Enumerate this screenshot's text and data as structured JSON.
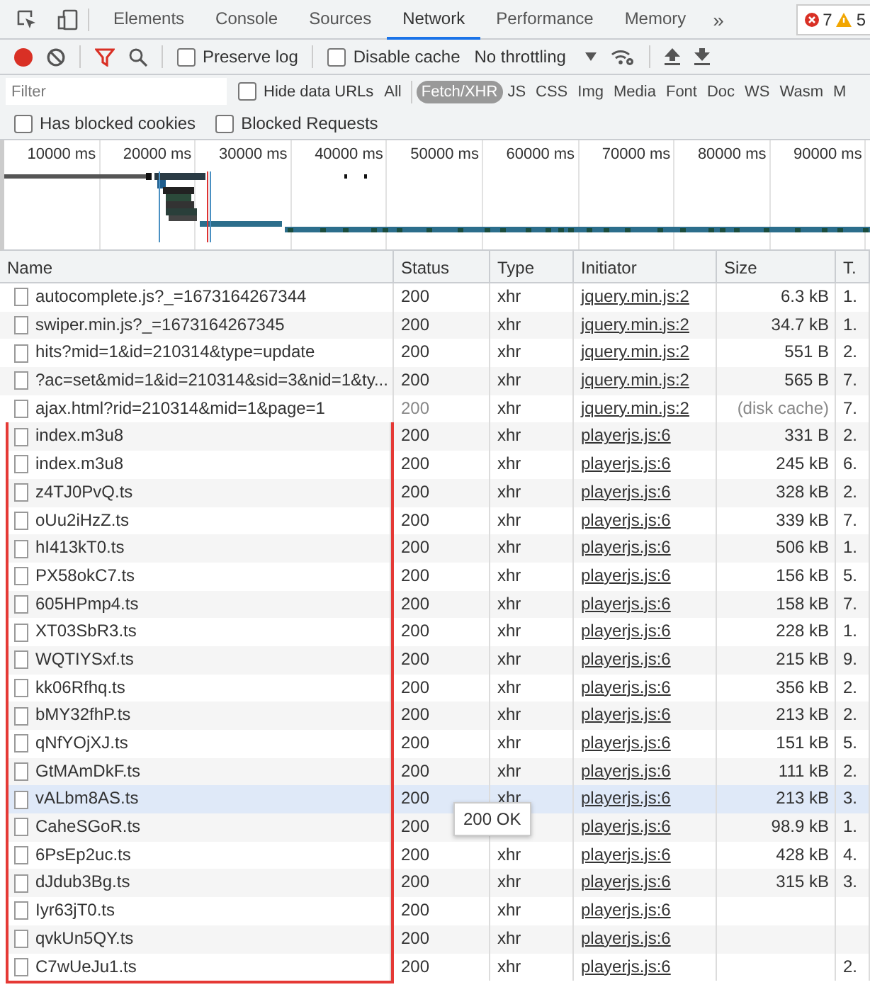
{
  "tabs": [
    {
      "label": "Elements",
      "selected": false
    },
    {
      "label": "Console",
      "selected": false
    },
    {
      "label": "Sources",
      "selected": false
    },
    {
      "label": "Network",
      "selected": true
    },
    {
      "label": "Performance",
      "selected": false
    },
    {
      "label": "Memory",
      "selected": false
    }
  ],
  "more_tabs": "»",
  "issues": {
    "errors": "7",
    "warnings": "5"
  },
  "toolbar": {
    "recording": true,
    "preserve_log": {
      "label": "Preserve log",
      "checked": false
    },
    "disable_cache": {
      "label": "Disable cache",
      "checked": false
    },
    "throttling": "No throttling"
  },
  "filter": {
    "placeholder": "Filter",
    "hide_data_urls": {
      "label": "Hide data URLs",
      "checked": false
    },
    "types": [
      {
        "label": "All",
        "selected": false
      },
      {
        "label": "Fetch/XHR",
        "selected": true
      },
      {
        "label": "JS",
        "selected": false
      },
      {
        "label": "CSS",
        "selected": false
      },
      {
        "label": "Img",
        "selected": false
      },
      {
        "label": "Media",
        "selected": false
      },
      {
        "label": "Font",
        "selected": false
      },
      {
        "label": "Doc",
        "selected": false
      },
      {
        "label": "WS",
        "selected": false
      },
      {
        "label": "Wasm",
        "selected": false
      },
      {
        "label": "M",
        "selected": false
      }
    ]
  },
  "blocked": [
    {
      "label": "Has blocked cookies",
      "checked": false
    },
    {
      "label": "Blocked Requests",
      "checked": false
    }
  ],
  "overview": {
    "ticks": [
      "10000 ms",
      "20000 ms",
      "30000 ms",
      "40000 ms",
      "50000 ms",
      "60000 ms",
      "70000 ms",
      "80000 ms",
      "90000 ms"
    ]
  },
  "table": {
    "columns": [
      "Name",
      "Status",
      "Type",
      "Initiator",
      "Size",
      "T."
    ],
    "rows": [
      {
        "name": "autocomplete.js?_=1673164267344",
        "status": "200",
        "type": "xhr",
        "initiator": "jquery.min.js:2",
        "size": "6.3 kB",
        "time": "1.",
        "from_cache": false,
        "boxed": false,
        "hovered": false
      },
      {
        "name": "swiper.min.js?_=1673164267345",
        "status": "200",
        "type": "xhr",
        "initiator": "jquery.min.js:2",
        "size": "34.7 kB",
        "time": "1.",
        "from_cache": false,
        "boxed": false,
        "hovered": false
      },
      {
        "name": "hits?mid=1&id=210314&type=update",
        "status": "200",
        "type": "xhr",
        "initiator": "jquery.min.js:2",
        "size": "551 B",
        "time": "2.",
        "from_cache": false,
        "boxed": false,
        "hovered": false
      },
      {
        "name": "?ac=set&mid=1&id=210314&sid=3&nid=1&ty...",
        "status": "200",
        "type": "xhr",
        "initiator": "jquery.min.js:2",
        "size": "565 B",
        "time": "7.",
        "from_cache": false,
        "boxed": false,
        "hovered": false
      },
      {
        "name": "ajax.html?rid=210314&mid=1&page=1",
        "status": "200",
        "type": "xhr",
        "initiator": "jquery.min.js:2",
        "size": "(disk cache)",
        "time": "7.",
        "from_cache": true,
        "boxed": false,
        "hovered": false
      },
      {
        "name": "index.m3u8",
        "status": "200",
        "type": "xhr",
        "initiator": "playerjs.js:6",
        "size": "331 B",
        "time": "2.",
        "from_cache": false,
        "boxed": true,
        "hovered": false
      },
      {
        "name": "index.m3u8",
        "status": "200",
        "type": "xhr",
        "initiator": "playerjs.js:6",
        "size": "245 kB",
        "time": "6.",
        "from_cache": false,
        "boxed": true,
        "hovered": false
      },
      {
        "name": "z4TJ0PvQ.ts",
        "status": "200",
        "type": "xhr",
        "initiator": "playerjs.js:6",
        "size": "328 kB",
        "time": "2.",
        "from_cache": false,
        "boxed": true,
        "hovered": false
      },
      {
        "name": "oUu2iHzZ.ts",
        "status": "200",
        "type": "xhr",
        "initiator": "playerjs.js:6",
        "size": "339 kB",
        "time": "7.",
        "from_cache": false,
        "boxed": true,
        "hovered": false
      },
      {
        "name": "hI413kT0.ts",
        "status": "200",
        "type": "xhr",
        "initiator": "playerjs.js:6",
        "size": "506 kB",
        "time": "1.",
        "from_cache": false,
        "boxed": true,
        "hovered": false
      },
      {
        "name": "PX58okC7.ts",
        "status": "200",
        "type": "xhr",
        "initiator": "playerjs.js:6",
        "size": "156 kB",
        "time": "5.",
        "from_cache": false,
        "boxed": true,
        "hovered": false
      },
      {
        "name": "605HPmp4.ts",
        "status": "200",
        "type": "xhr",
        "initiator": "playerjs.js:6",
        "size": "158 kB",
        "time": "7.",
        "from_cache": false,
        "boxed": true,
        "hovered": false
      },
      {
        "name": "XT03SbR3.ts",
        "status": "200",
        "type": "xhr",
        "initiator": "playerjs.js:6",
        "size": "228 kB",
        "time": "1.",
        "from_cache": false,
        "boxed": true,
        "hovered": false
      },
      {
        "name": "WQTIYSxf.ts",
        "status": "200",
        "type": "xhr",
        "initiator": "playerjs.js:6",
        "size": "215 kB",
        "time": "9.",
        "from_cache": false,
        "boxed": true,
        "hovered": false
      },
      {
        "name": "kk06Rfhq.ts",
        "status": "200",
        "type": "xhr",
        "initiator": "playerjs.js:6",
        "size": "356 kB",
        "time": "2.",
        "from_cache": false,
        "boxed": true,
        "hovered": false
      },
      {
        "name": "bMY32fhP.ts",
        "status": "200",
        "type": "xhr",
        "initiator": "playerjs.js:6",
        "size": "213 kB",
        "time": "2.",
        "from_cache": false,
        "boxed": true,
        "hovered": false
      },
      {
        "name": "qNfYOjXJ.ts",
        "status": "200",
        "type": "xhr",
        "initiator": "playerjs.js:6",
        "size": "151 kB",
        "time": "5.",
        "from_cache": false,
        "boxed": true,
        "hovered": false
      },
      {
        "name": "GtMAmDkF.ts",
        "status": "200",
        "type": "xhr",
        "initiator": "playerjs.js:6",
        "size": "111 kB",
        "time": "2.",
        "from_cache": false,
        "boxed": true,
        "hovered": false
      },
      {
        "name": "vALbm8AS.ts",
        "status": "200",
        "type": "xhr",
        "initiator": "playerjs.js:6",
        "size": "213 kB",
        "time": "3.",
        "from_cache": false,
        "boxed": true,
        "hovered": true,
        "tooltip": "200 OK"
      },
      {
        "name": "CaheSGoR.ts",
        "status": "200",
        "initiator": "playerjs.js:6",
        "size": "98.9 kB",
        "time": "1.",
        "from_cache": false,
        "boxed": true,
        "hovered": false
      },
      {
        "name": "6PsEp2uc.ts",
        "status": "200",
        "type": "xhr",
        "initiator": "playerjs.js:6",
        "size": "428 kB",
        "time": "4.",
        "from_cache": false,
        "boxed": true,
        "hovered": false
      },
      {
        "name": "dJdub3Bg.ts",
        "status": "200",
        "type": "xhr",
        "initiator": "playerjs.js:6",
        "size": "315 kB",
        "time": "3.",
        "from_cache": false,
        "boxed": true,
        "hovered": false
      },
      {
        "name": "Iyr63jT0.ts",
        "status": "200",
        "type": "xhr",
        "initiator": "playerjs.js:6",
        "from_cache": false,
        "boxed": true,
        "hovered": false
      },
      {
        "name": "qvkUn5QY.ts",
        "status": "200",
        "type": "xhr",
        "initiator": "playerjs.js:6",
        "from_cache": false,
        "boxed": true,
        "hovered": false
      },
      {
        "name": "C7wUeJu1.ts",
        "status": "200",
        "type": "xhr",
        "initiator": "playerjs.js:6",
        "time": "2.",
        "from_cache": false,
        "boxed": true,
        "hovered": false
      }
    ]
  }
}
